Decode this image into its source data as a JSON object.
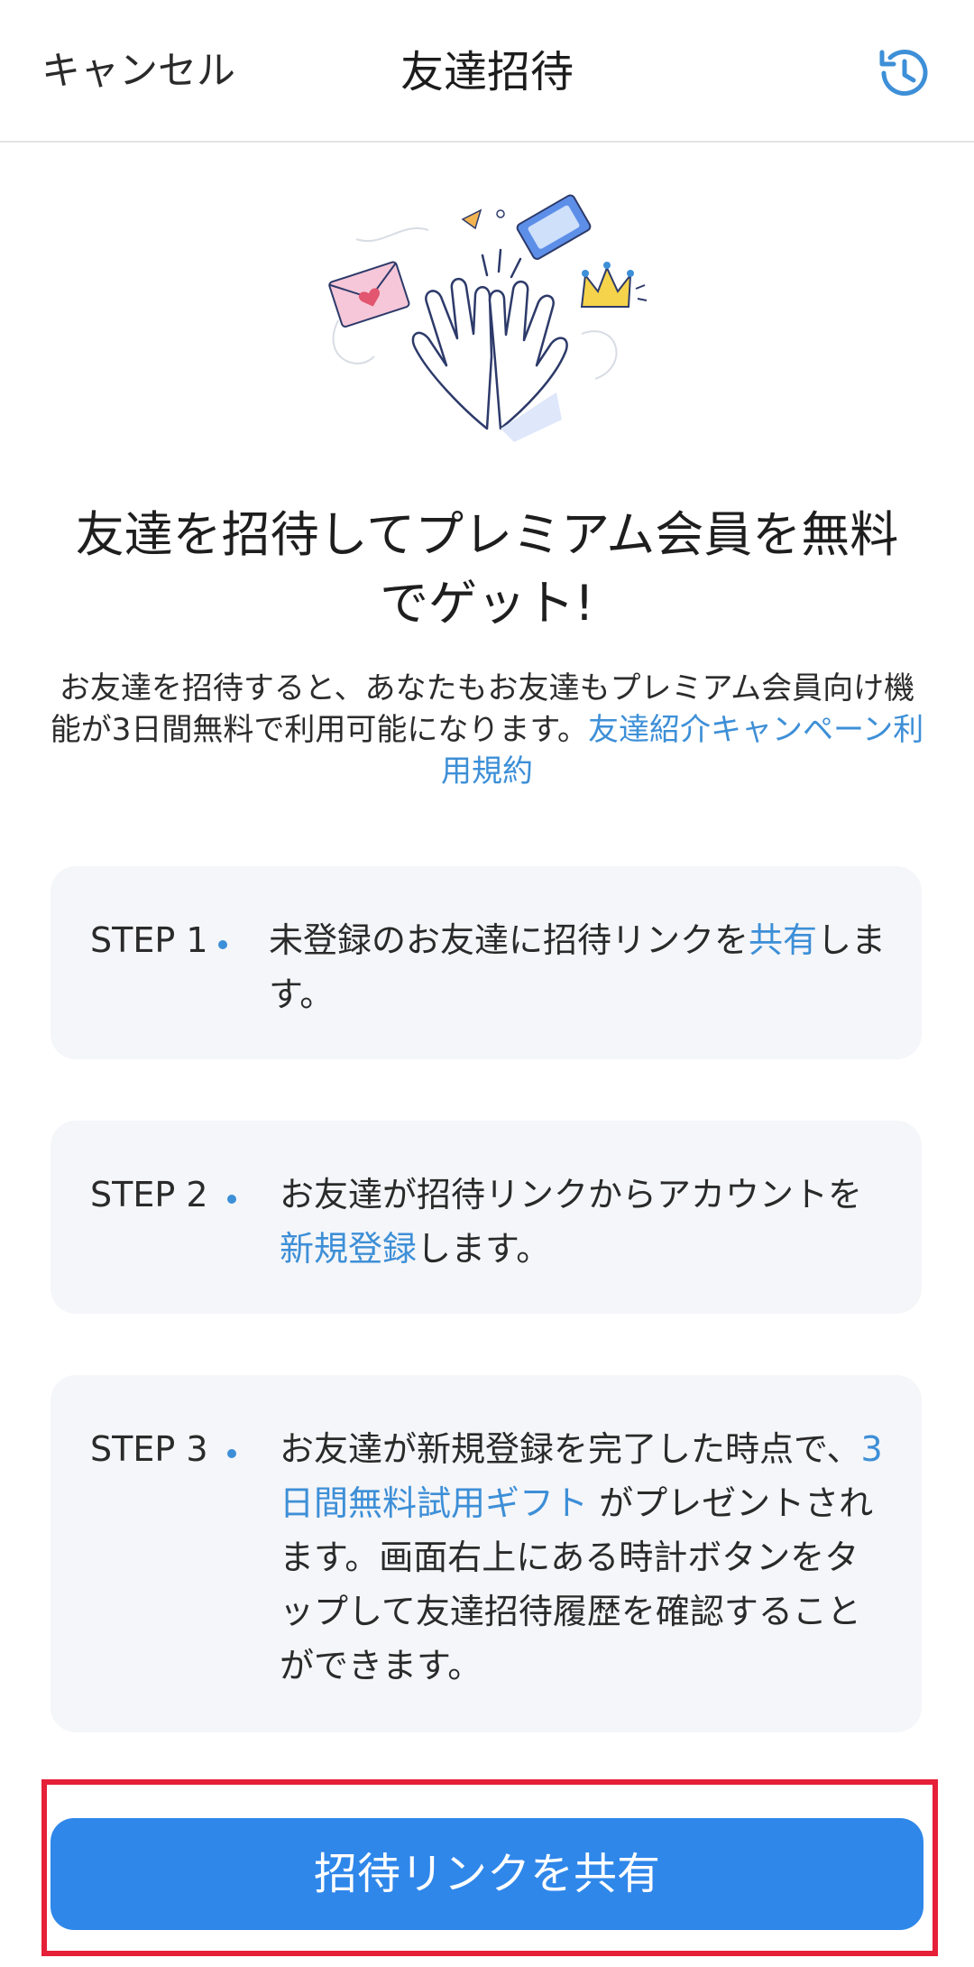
{
  "header": {
    "cancel_label": "キャンセル",
    "title": "友達招待",
    "history_icon": "history-clock-icon"
  },
  "illustration": {
    "icon": "high-five-illustration"
  },
  "headline": {
    "line1": "友達を招待してプレミアム会員を無料",
    "line2": "でゲット!"
  },
  "description": {
    "text": "お友達を招待すると、あなたもお友達もプレミアム会員向け機能が3日間無料で利用可能になります。",
    "terms_link": "友達紹介キャンペーン利用規約"
  },
  "steps": [
    {
      "label": "STEP 1",
      "parts": [
        "未登録のお友達に招待リンクを",
        "共有",
        "します。"
      ]
    },
    {
      "label": "STEP 2",
      "parts": [
        "お友達が招待リンクからアカウントを",
        "新規登録",
        "します。"
      ]
    },
    {
      "label": "STEP 3",
      "parts": [
        "お友達が新規登録を完了した時点で、",
        "3日間無料試用ギフト",
        " がプレゼントされます。画面右上にある時計ボタンをタップして友達招待履歴を確認することができます。"
      ]
    }
  ],
  "cta": {
    "label": "招待リンクを共有"
  },
  "colors": {
    "accent": "#3d8fd7",
    "button": "#2f87ea",
    "card_bg": "#f5f6f9",
    "highlight_border": "#e52038"
  }
}
